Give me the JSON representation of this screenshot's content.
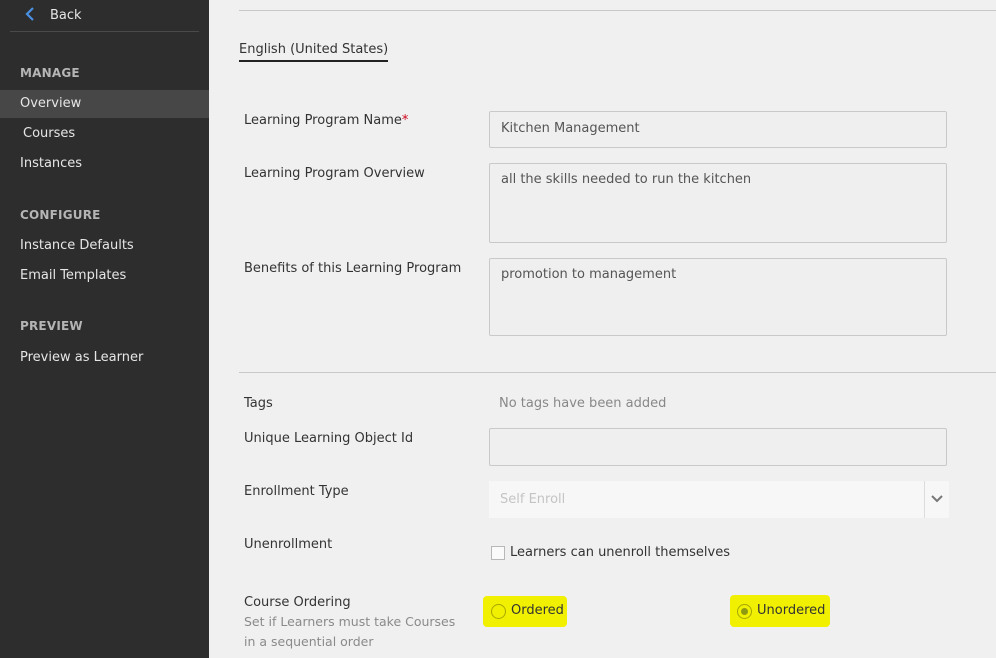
{
  "sidebar": {
    "back_label": "Back",
    "sections": [
      {
        "heading": "MANAGE",
        "items": [
          "Overview",
          "Courses",
          "Instances"
        ]
      },
      {
        "heading": "CONFIGURE",
        "items": [
          "Instance Defaults",
          "Email Templates"
        ]
      },
      {
        "heading": "PREVIEW",
        "items": [
          "Preview as Learner"
        ]
      }
    ],
    "active_item": "Overview"
  },
  "main": {
    "language_tab": "English (United States)",
    "fields": {
      "name_label": "Learning Program Name",
      "name_required_mark": "*",
      "name_value": "Kitchen Management",
      "overview_label": "Learning Program Overview",
      "overview_value": "all the skills needed to run the kitchen",
      "benefits_label": "Benefits of this Learning Program",
      "benefits_value": "promotion to management",
      "tags_label": "Tags",
      "tags_value": "No tags have been added",
      "uid_label": "Unique Learning Object Id",
      "uid_value": "",
      "enrollment_label": "Enrollment Type",
      "enrollment_value": "Self Enroll",
      "unenrollment_label": "Unenrollment",
      "unenrollment_checkbox_label": "Learners can unenroll themselves",
      "unenrollment_checked": false,
      "ordering_label": "Course Ordering",
      "ordering_note": "Set if Learners must take Courses in a sequential order",
      "ordering_options": [
        "Ordered",
        "Unordered"
      ],
      "ordering_selected": "Unordered"
    }
  },
  "colors": {
    "sidebar_bg": "#2d2d2d",
    "sidebar_active": "#474747",
    "back_chevron": "#4a90e2",
    "highlight": "#f0f000",
    "required": "#d0021b"
  }
}
